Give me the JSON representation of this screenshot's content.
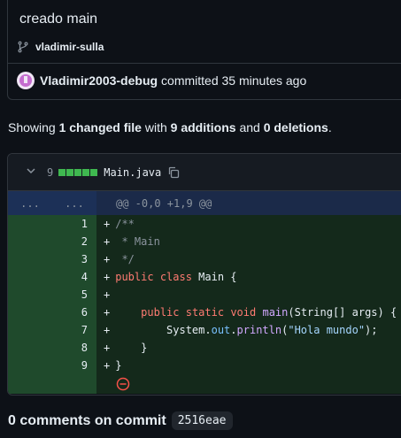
{
  "commit": {
    "title": "creado main",
    "branch": "vladimir-sulla",
    "author": "Vladimir2003-debug",
    "committed_text": "committed 35 minutes ago"
  },
  "summary": {
    "showing": "Showing",
    "files": "1 changed file",
    "with": "with",
    "additions": "9 additions",
    "and": "and",
    "deletions": "0 deletions",
    "period": "."
  },
  "file": {
    "change_count": "9",
    "diffstat_colors": [
      "#3fb950",
      "#3fb950",
      "#3fb950",
      "#3fb950",
      "#3fb950"
    ],
    "name": "Main.java",
    "hunk_left": "...",
    "hunk_right": "...",
    "hunk_header": "@@ -0,0 +1,9 @@",
    "lines": [
      {
        "n": "1",
        "code": "/**"
      },
      {
        "n": "2",
        "code": " * Main"
      },
      {
        "n": "3",
        "code": " */"
      },
      {
        "n": "4",
        "code": "public class Main {"
      },
      {
        "n": "5",
        "code": ""
      },
      {
        "n": "6",
        "code": "    public static void main(String[] args) {"
      },
      {
        "n": "7",
        "code": "        System.out.println(\"Hola mundo\");"
      },
      {
        "n": "8",
        "code": "    }"
      },
      {
        "n": "9",
        "code": "}"
      }
    ]
  },
  "comments": {
    "title": "0 comments on commit",
    "sha": "2516eae"
  }
}
